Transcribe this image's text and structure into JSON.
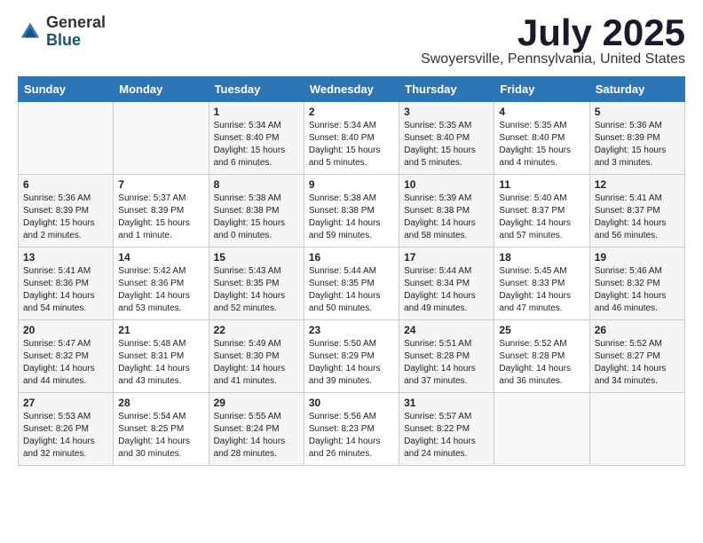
{
  "header": {
    "logo_general": "General",
    "logo_blue": "Blue",
    "month_title": "July 2025",
    "location": "Swoyersville, Pennsylvania, United States"
  },
  "weekdays": [
    "Sunday",
    "Monday",
    "Tuesday",
    "Wednesday",
    "Thursday",
    "Friday",
    "Saturday"
  ],
  "weeks": [
    [
      {
        "day": "",
        "sunrise": "",
        "sunset": "",
        "daylight": ""
      },
      {
        "day": "",
        "sunrise": "",
        "sunset": "",
        "daylight": ""
      },
      {
        "day": "1",
        "sunrise": "Sunrise: 5:34 AM",
        "sunset": "Sunset: 8:40 PM",
        "daylight": "Daylight: 15 hours and 6 minutes."
      },
      {
        "day": "2",
        "sunrise": "Sunrise: 5:34 AM",
        "sunset": "Sunset: 8:40 PM",
        "daylight": "Daylight: 15 hours and 5 minutes."
      },
      {
        "day": "3",
        "sunrise": "Sunrise: 5:35 AM",
        "sunset": "Sunset: 8:40 PM",
        "daylight": "Daylight: 15 hours and 5 minutes."
      },
      {
        "day": "4",
        "sunrise": "Sunrise: 5:35 AM",
        "sunset": "Sunset: 8:40 PM",
        "daylight": "Daylight: 15 hours and 4 minutes."
      },
      {
        "day": "5",
        "sunrise": "Sunrise: 5:36 AM",
        "sunset": "Sunset: 8:39 PM",
        "daylight": "Daylight: 15 hours and 3 minutes."
      }
    ],
    [
      {
        "day": "6",
        "sunrise": "Sunrise: 5:36 AM",
        "sunset": "Sunset: 8:39 PM",
        "daylight": "Daylight: 15 hours and 2 minutes."
      },
      {
        "day": "7",
        "sunrise": "Sunrise: 5:37 AM",
        "sunset": "Sunset: 8:39 PM",
        "daylight": "Daylight: 15 hours and 1 minute."
      },
      {
        "day": "8",
        "sunrise": "Sunrise: 5:38 AM",
        "sunset": "Sunset: 8:38 PM",
        "daylight": "Daylight: 15 hours and 0 minutes."
      },
      {
        "day": "9",
        "sunrise": "Sunrise: 5:38 AM",
        "sunset": "Sunset: 8:38 PM",
        "daylight": "Daylight: 14 hours and 59 minutes."
      },
      {
        "day": "10",
        "sunrise": "Sunrise: 5:39 AM",
        "sunset": "Sunset: 8:38 PM",
        "daylight": "Daylight: 14 hours and 58 minutes."
      },
      {
        "day": "11",
        "sunrise": "Sunrise: 5:40 AM",
        "sunset": "Sunset: 8:37 PM",
        "daylight": "Daylight: 14 hours and 57 minutes."
      },
      {
        "day": "12",
        "sunrise": "Sunrise: 5:41 AM",
        "sunset": "Sunset: 8:37 PM",
        "daylight": "Daylight: 14 hours and 56 minutes."
      }
    ],
    [
      {
        "day": "13",
        "sunrise": "Sunrise: 5:41 AM",
        "sunset": "Sunset: 8:36 PM",
        "daylight": "Daylight: 14 hours and 54 minutes."
      },
      {
        "day": "14",
        "sunrise": "Sunrise: 5:42 AM",
        "sunset": "Sunset: 8:36 PM",
        "daylight": "Daylight: 14 hours and 53 minutes."
      },
      {
        "day": "15",
        "sunrise": "Sunrise: 5:43 AM",
        "sunset": "Sunset: 8:35 PM",
        "daylight": "Daylight: 14 hours and 52 minutes."
      },
      {
        "day": "16",
        "sunrise": "Sunrise: 5:44 AM",
        "sunset": "Sunset: 8:35 PM",
        "daylight": "Daylight: 14 hours and 50 minutes."
      },
      {
        "day": "17",
        "sunrise": "Sunrise: 5:44 AM",
        "sunset": "Sunset: 8:34 PM",
        "daylight": "Daylight: 14 hours and 49 minutes."
      },
      {
        "day": "18",
        "sunrise": "Sunrise: 5:45 AM",
        "sunset": "Sunset: 8:33 PM",
        "daylight": "Daylight: 14 hours and 47 minutes."
      },
      {
        "day": "19",
        "sunrise": "Sunrise: 5:46 AM",
        "sunset": "Sunset: 8:32 PM",
        "daylight": "Daylight: 14 hours and 46 minutes."
      }
    ],
    [
      {
        "day": "20",
        "sunrise": "Sunrise: 5:47 AM",
        "sunset": "Sunset: 8:32 PM",
        "daylight": "Daylight: 14 hours and 44 minutes."
      },
      {
        "day": "21",
        "sunrise": "Sunrise: 5:48 AM",
        "sunset": "Sunset: 8:31 PM",
        "daylight": "Daylight: 14 hours and 43 minutes."
      },
      {
        "day": "22",
        "sunrise": "Sunrise: 5:49 AM",
        "sunset": "Sunset: 8:30 PM",
        "daylight": "Daylight: 14 hours and 41 minutes."
      },
      {
        "day": "23",
        "sunrise": "Sunrise: 5:50 AM",
        "sunset": "Sunset: 8:29 PM",
        "daylight": "Daylight: 14 hours and 39 minutes."
      },
      {
        "day": "24",
        "sunrise": "Sunrise: 5:51 AM",
        "sunset": "Sunset: 8:28 PM",
        "daylight": "Daylight: 14 hours and 37 minutes."
      },
      {
        "day": "25",
        "sunrise": "Sunrise: 5:52 AM",
        "sunset": "Sunset: 8:28 PM",
        "daylight": "Daylight: 14 hours and 36 minutes."
      },
      {
        "day": "26",
        "sunrise": "Sunrise: 5:52 AM",
        "sunset": "Sunset: 8:27 PM",
        "daylight": "Daylight: 14 hours and 34 minutes."
      }
    ],
    [
      {
        "day": "27",
        "sunrise": "Sunrise: 5:53 AM",
        "sunset": "Sunset: 8:26 PM",
        "daylight": "Daylight: 14 hours and 32 minutes."
      },
      {
        "day": "28",
        "sunrise": "Sunrise: 5:54 AM",
        "sunset": "Sunset: 8:25 PM",
        "daylight": "Daylight: 14 hours and 30 minutes."
      },
      {
        "day": "29",
        "sunrise": "Sunrise: 5:55 AM",
        "sunset": "Sunset: 8:24 PM",
        "daylight": "Daylight: 14 hours and 28 minutes."
      },
      {
        "day": "30",
        "sunrise": "Sunrise: 5:56 AM",
        "sunset": "Sunset: 8:23 PM",
        "daylight": "Daylight: 14 hours and 26 minutes."
      },
      {
        "day": "31",
        "sunrise": "Sunrise: 5:57 AM",
        "sunset": "Sunset: 8:22 PM",
        "daylight": "Daylight: 14 hours and 24 minutes."
      },
      {
        "day": "",
        "sunrise": "",
        "sunset": "",
        "daylight": ""
      },
      {
        "day": "",
        "sunrise": "",
        "sunset": "",
        "daylight": ""
      }
    ]
  ]
}
